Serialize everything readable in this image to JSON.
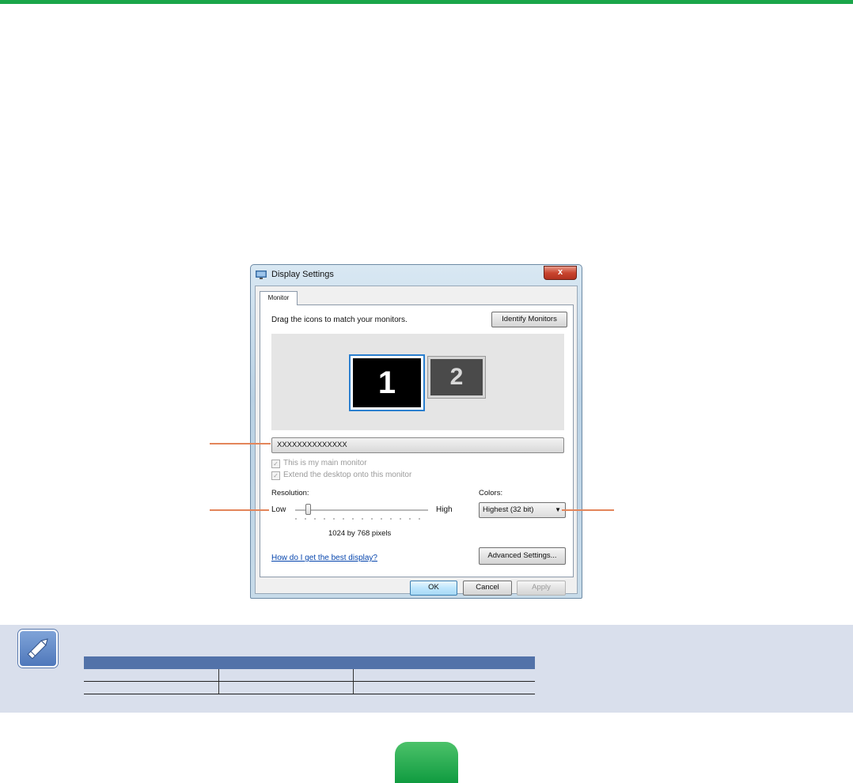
{
  "dialog": {
    "title": "Display Settings",
    "close_glyph": "x",
    "tab_label": "Monitor",
    "drag_instruction": "Drag the icons to match your monitors.",
    "identify_button": "Identify Monitors",
    "monitors": [
      {
        "label": "1",
        "selected": true
      },
      {
        "label": "2",
        "selected": false
      }
    ],
    "monitor_select": "XXXXXXXXXXXXXX",
    "checkbox_main": "This is my main monitor",
    "checkbox_extend": "Extend the desktop onto this monitor",
    "resolution_label": "Resolution:",
    "low_label": "Low",
    "high_label": "High",
    "resolution_value": "1024 by 768 pixels",
    "slider_position_fraction": 0.1,
    "colors_label": "Colors:",
    "colors_value": "Highest (32 bit)",
    "help_link": "How do I get the best display?",
    "advanced_button": "Advanced Settings...",
    "ok_button": "OK",
    "cancel_button": "Cancel",
    "apply_button": "Apply"
  },
  "note": {
    "icon": "pencil-note-icon",
    "table_rows": 2,
    "table_columns": 3
  },
  "colors": {
    "top_rule": "#1aa64a",
    "callout": "#e3855a",
    "note_background": "#d9dfec",
    "table_header": "#5272a9",
    "page_tab": "#1aa64a"
  }
}
